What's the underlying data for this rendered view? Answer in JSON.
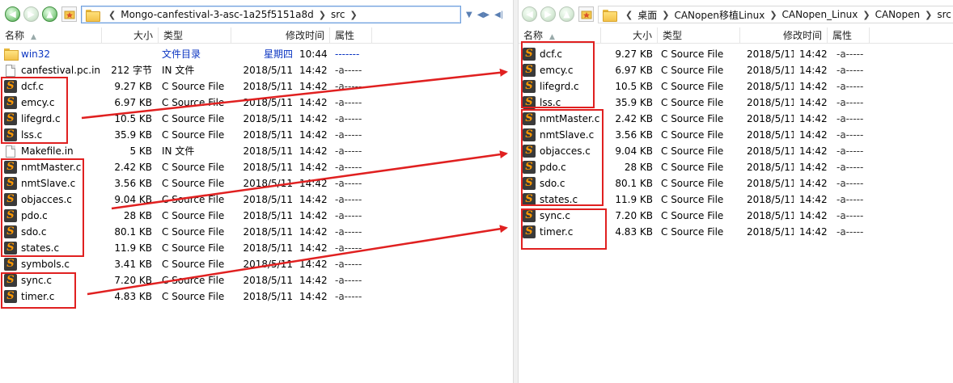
{
  "left": {
    "path": [
      "Mongo-canfestival-3-asc-1a25f5151a8d",
      "src"
    ],
    "columns": {
      "name": "名称",
      "size": "大小",
      "type": "类型",
      "date": "修改时间",
      "attr": "属性"
    },
    "files": [
      {
        "icon": "folder-icon",
        "name": "win32",
        "size": "",
        "type": "文件目录",
        "date": "星期四",
        "time": "10:44",
        "attr": "-------",
        "kind": "folder"
      },
      {
        "icon": "blank-file-icon",
        "name": "canfestival.pc.in",
        "size": "212 字节",
        "type": "IN 文件",
        "date": "2018/5/11",
        "time": "14:42",
        "attr": "-a-----",
        "kind": "file"
      },
      {
        "icon": "sublime-file-icon",
        "name": "dcf.c",
        "size": "9.27 KB",
        "type": "C Source File",
        "date": "2018/5/11",
        "time": "14:42",
        "attr": "-a-----",
        "kind": "c"
      },
      {
        "icon": "sublime-file-icon",
        "name": "emcy.c",
        "size": "6.97 KB",
        "type": "C Source File",
        "date": "2018/5/11",
        "time": "14:42",
        "attr": "-a-----",
        "kind": "c"
      },
      {
        "icon": "sublime-file-icon",
        "name": "lifegrd.c",
        "size": "10.5 KB",
        "type": "C Source File",
        "date": "2018/5/11",
        "time": "14:42",
        "attr": "-a-----",
        "kind": "c"
      },
      {
        "icon": "sublime-file-icon",
        "name": "lss.c",
        "size": "35.9 KB",
        "type": "C Source File",
        "date": "2018/5/11",
        "time": "14:42",
        "attr": "-a-----",
        "kind": "c"
      },
      {
        "icon": "blank-file-icon",
        "name": "Makefile.in",
        "size": "5 KB",
        "type": "IN 文件",
        "date": "2018/5/11",
        "time": "14:42",
        "attr": "-a-----",
        "kind": "file"
      },
      {
        "icon": "sublime-file-icon",
        "name": "nmtMaster.c",
        "size": "2.42 KB",
        "type": "C Source File",
        "date": "2018/5/11",
        "time": "14:42",
        "attr": "-a-----",
        "kind": "c"
      },
      {
        "icon": "sublime-file-icon",
        "name": "nmtSlave.c",
        "size": "3.56 KB",
        "type": "C Source File",
        "date": "2018/5/11",
        "time": "14:42",
        "attr": "-a-----",
        "kind": "c"
      },
      {
        "icon": "sublime-file-icon",
        "name": "objacces.c",
        "size": "9.04 KB",
        "type": "C Source File",
        "date": "2018/5/11",
        "time": "14:42",
        "attr": "-a-----",
        "kind": "c"
      },
      {
        "icon": "sublime-file-icon",
        "name": "pdo.c",
        "size": "28 KB",
        "type": "C Source File",
        "date": "2018/5/11",
        "time": "14:42",
        "attr": "-a-----",
        "kind": "c"
      },
      {
        "icon": "sublime-file-icon",
        "name": "sdo.c",
        "size": "80.1 KB",
        "type": "C Source File",
        "date": "2018/5/11",
        "time": "14:42",
        "attr": "-a-----",
        "kind": "c"
      },
      {
        "icon": "sublime-file-icon",
        "name": "states.c",
        "size": "11.9 KB",
        "type": "C Source File",
        "date": "2018/5/11",
        "time": "14:42",
        "attr": "-a-----",
        "kind": "c"
      },
      {
        "icon": "sublime-file-icon",
        "name": "symbols.c",
        "size": "3.41 KB",
        "type": "C Source File",
        "date": "2018/5/11",
        "time": "14:42",
        "attr": "-a-----",
        "kind": "c"
      },
      {
        "icon": "sublime-file-icon",
        "name": "sync.c",
        "size": "7.20 KB",
        "type": "C Source File",
        "date": "2018/5/11",
        "time": "14:42",
        "attr": "-a-----",
        "kind": "c"
      },
      {
        "icon": "sublime-file-icon",
        "name": "timer.c",
        "size": "4.83 KB",
        "type": "C Source File",
        "date": "2018/5/11",
        "time": "14:42",
        "attr": "-a-----",
        "kind": "c"
      }
    ]
  },
  "right": {
    "path": [
      "桌面",
      "CANopen移植Linux",
      "CANopen_Linux",
      "CANopen",
      "src"
    ],
    "columns": {
      "name": "名称",
      "size": "大小",
      "type": "类型",
      "date": "修改时间",
      "attr": "属性"
    },
    "files": [
      {
        "icon": "sublime-file-icon",
        "name": "dcf.c",
        "size": "9.27 KB",
        "type": "C Source File",
        "date": "2018/5/11",
        "time": "14:42",
        "attr": "-a-----",
        "kind": "c"
      },
      {
        "icon": "sublime-file-icon",
        "name": "emcy.c",
        "size": "6.97 KB",
        "type": "C Source File",
        "date": "2018/5/11",
        "time": "14:42",
        "attr": "-a-----",
        "kind": "c"
      },
      {
        "icon": "sublime-file-icon",
        "name": "lifegrd.c",
        "size": "10.5 KB",
        "type": "C Source File",
        "date": "2018/5/11",
        "time": "14:42",
        "attr": "-a-----",
        "kind": "c"
      },
      {
        "icon": "sublime-file-icon",
        "name": "lss.c",
        "size": "35.9 KB",
        "type": "C Source File",
        "date": "2018/5/11",
        "time": "14:42",
        "attr": "-a-----",
        "kind": "c"
      },
      {
        "icon": "sublime-file-icon",
        "name": "nmtMaster.c",
        "size": "2.42 KB",
        "type": "C Source File",
        "date": "2018/5/11",
        "time": "14:42",
        "attr": "-a-----",
        "kind": "c"
      },
      {
        "icon": "sublime-file-icon",
        "name": "nmtSlave.c",
        "size": "3.56 KB",
        "type": "C Source File",
        "date": "2018/5/11",
        "time": "14:42",
        "attr": "-a-----",
        "kind": "c"
      },
      {
        "icon": "sublime-file-icon",
        "name": "objacces.c",
        "size": "9.04 KB",
        "type": "C Source File",
        "date": "2018/5/11",
        "time": "14:42",
        "attr": "-a-----",
        "kind": "c"
      },
      {
        "icon": "sublime-file-icon",
        "name": "pdo.c",
        "size": "28 KB",
        "type": "C Source File",
        "date": "2018/5/11",
        "time": "14:42",
        "attr": "-a-----",
        "kind": "c"
      },
      {
        "icon": "sublime-file-icon",
        "name": "sdo.c",
        "size": "80.1 KB",
        "type": "C Source File",
        "date": "2018/5/11",
        "time": "14:42",
        "attr": "-a-----",
        "kind": "c"
      },
      {
        "icon": "sublime-file-icon",
        "name": "states.c",
        "size": "11.9 KB",
        "type": "C Source File",
        "date": "2018/5/11",
        "time": "14:42",
        "attr": "-a-----",
        "kind": "c"
      },
      {
        "icon": "sublime-file-icon",
        "name": "sync.c",
        "size": "7.20 KB",
        "type": "C Source File",
        "date": "2018/5/11",
        "time": "14:42",
        "attr": "-a-----",
        "kind": "c"
      },
      {
        "icon": "sublime-file-icon",
        "name": "timer.c",
        "size": "4.83 KB",
        "type": "C Source File",
        "date": "2018/5/11",
        "time": "14:42",
        "attr": "-a-----",
        "kind": "c"
      }
    ]
  },
  "colors": {
    "annotation_red": "#e02020",
    "folder_text_blue": "#0b35c2",
    "sublime_orange": "#ff9800"
  }
}
